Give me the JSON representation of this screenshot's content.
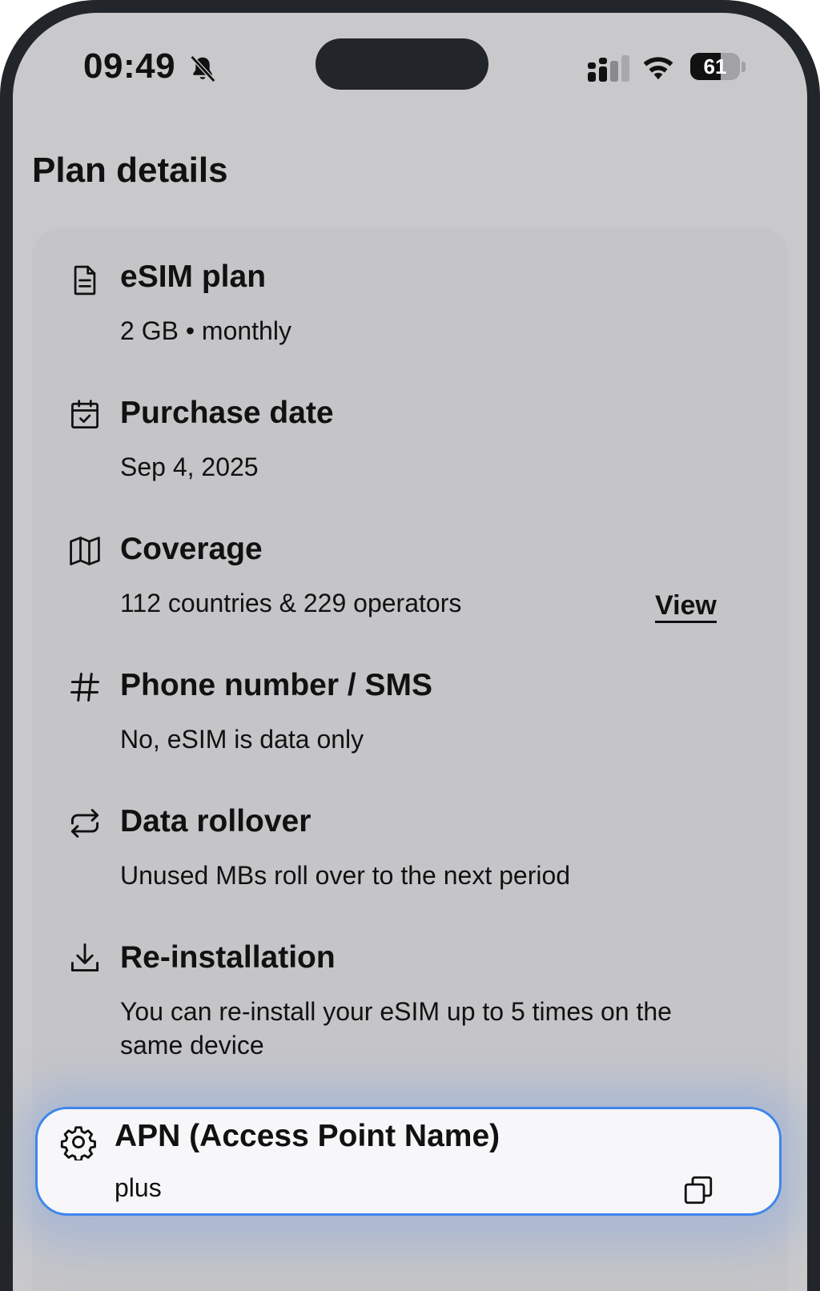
{
  "status_bar": {
    "time": "09:49",
    "battery_level": "61",
    "battery_fraction": 0.61,
    "icons": [
      "bell-slash-icon",
      "signal-icon",
      "wifi-icon",
      "battery-icon"
    ]
  },
  "page": {
    "title": "Plan details"
  },
  "plan_rows": [
    {
      "icon": "document-icon",
      "title": "eSIM plan",
      "value": "2 GB • monthly"
    },
    {
      "icon": "calendar-check-icon",
      "title": "Purchase date",
      "value": "Sep 4, 2025"
    },
    {
      "icon": "map-icon",
      "title": "Coverage",
      "value": "112 countries & 229 operators",
      "action": "View"
    },
    {
      "icon": "hash-icon",
      "title": "Phone number / SMS",
      "value": "No, eSIM is data only"
    },
    {
      "icon": "repeat-icon",
      "title": "Data rollover",
      "value": "Unused MBs roll over to the next period"
    },
    {
      "icon": "download-icon",
      "title": "Re-installation",
      "value": "You can re-install your eSIM up to 5 times on the same device"
    }
  ],
  "apn": {
    "icon": "gear-icon",
    "title": "APN (Access Point Name)",
    "value": "plus",
    "copy_icon": "copy-icon"
  },
  "colors": {
    "screen_bg": "#c9c9cb",
    "card_bg": "#c5c5c8",
    "highlight_border": "#3f86ec",
    "text": "#111111"
  }
}
